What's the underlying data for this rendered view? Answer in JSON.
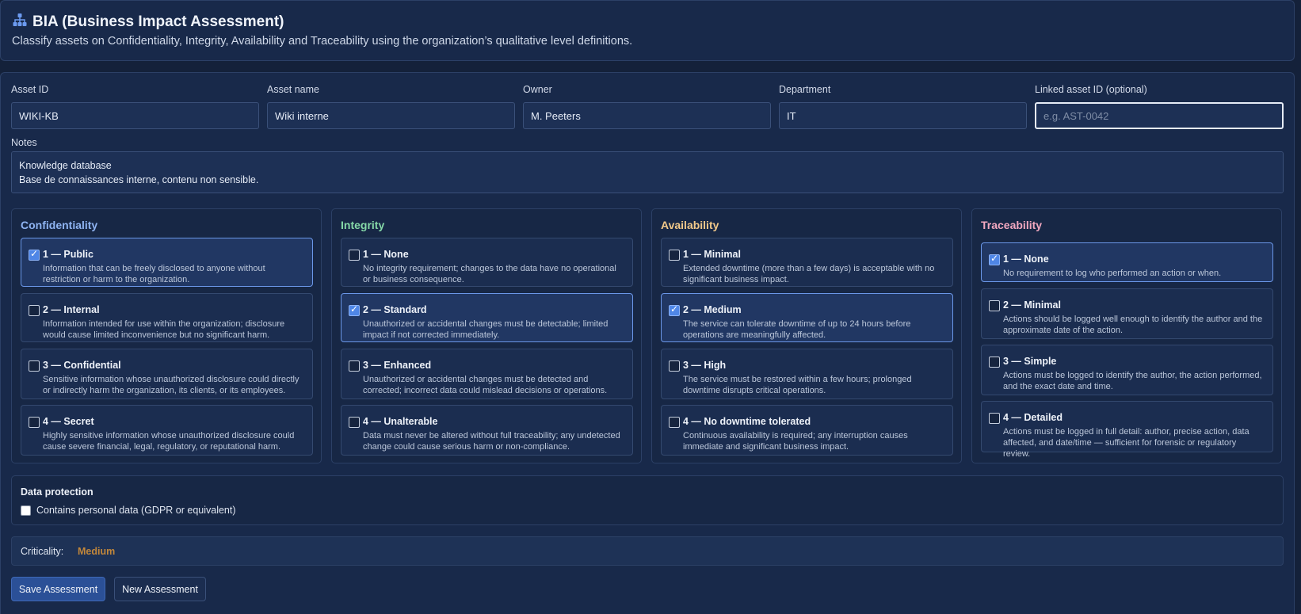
{
  "header": {
    "icon": "sitemap-icon",
    "title": "BIA (Business Impact Assessment)",
    "subtitle": "Classify assets on Confidentiality, Integrity, Availability and Traceability using the organization’s qualitative level definitions."
  },
  "form": {
    "asset_id": {
      "label": "Asset ID",
      "value": "WIKI-KB"
    },
    "asset_name": {
      "label": "Asset name",
      "value": "Wiki interne"
    },
    "owner": {
      "label": "Owner",
      "value": "M. Peeters"
    },
    "department": {
      "label": "Department",
      "value": "IT"
    },
    "linked_asset": {
      "label": "Linked asset ID (optional)",
      "value": "",
      "placeholder": "e.g. AST-0042"
    },
    "notes": {
      "label": "Notes",
      "value": "Knowledge database\nBase de connaissances interne, contenu non sensible."
    }
  },
  "dimensions": [
    {
      "title": "Confidentiality",
      "color": "#8fb4f2",
      "options": [
        {
          "label": "1 — Public",
          "desc": "Information that can be freely disclosed to anyone without restriction or harm to the organization.",
          "checked": true
        },
        {
          "label": "2 — Internal",
          "desc": "Information intended for use within the organization; disclosure would cause limited inconvenience but no significant harm.",
          "checked": false
        },
        {
          "label": "3 — Confidential",
          "desc": "Sensitive information whose unauthorized disclosure could directly or indirectly harm the organization, its clients, or its employees.",
          "checked": false
        },
        {
          "label": "4 — Secret",
          "desc": "Highly sensitive information whose unauthorized disclosure could cause severe financial, legal, regulatory, or reputational harm.",
          "checked": false
        }
      ]
    },
    {
      "title": "Integrity",
      "color": "#86d9a8",
      "options": [
        {
          "label": "1 — None",
          "desc": "No integrity requirement; changes to the data have no operational or business consequence.",
          "checked": false
        },
        {
          "label": "2 — Standard",
          "desc": "Unauthorized or accidental changes must be detectable; limited impact if not corrected immediately.",
          "checked": true
        },
        {
          "label": "3 — Enhanced",
          "desc": "Unauthorized or accidental changes must be detected and corrected; incorrect data could mislead decisions or operations.",
          "checked": false
        },
        {
          "label": "4 — Unalterable",
          "desc": "Data must never be altered without full traceability; any undetected change could cause serious harm or non-compliance.",
          "checked": false
        }
      ]
    },
    {
      "title": "Availability",
      "color": "#f2c98a",
      "options": [
        {
          "label": "1 — Minimal",
          "desc": "Extended downtime (more than a few days) is acceptable with no significant business impact.",
          "checked": false
        },
        {
          "label": "2 — Medium",
          "desc": "The service can tolerate downtime of up to 24 hours before operations are meaningfully affected.",
          "checked": true
        },
        {
          "label": "3 — High",
          "desc": "The service must be restored within a few hours; prolonged downtime disrupts critical operations.",
          "checked": false
        },
        {
          "label": "4 — No downtime tolerated",
          "desc": "Continuous availability is required; any interruption causes immediate and significant business impact.",
          "checked": false
        }
      ]
    },
    {
      "title": "Traceability",
      "color": "#f2a8c0",
      "options": [
        {
          "label": "1 — None",
          "desc": "No requirement to log who performed an action or when.",
          "checked": true
        },
        {
          "label": "2 — Minimal",
          "desc": "Actions should be logged well enough to identify the author and the approximate date of the action.",
          "checked": false
        },
        {
          "label": "3 — Simple",
          "desc": "Actions must be logged to identify the author, the action performed, and the exact date and time.",
          "checked": false
        },
        {
          "label": "4 — Detailed",
          "desc": "Actions must be logged in full detail: author, precise action, data affected, and date/time — sufficient for forensic or regulatory review.",
          "checked": false
        }
      ]
    }
  ],
  "data_protection": {
    "title": "Data protection",
    "personal_data_label": "Contains personal data (GDPR or equivalent)",
    "personal_data_checked": false
  },
  "criticality": {
    "label": "Criticality:",
    "value": "Medium",
    "color": "#c2873a"
  },
  "buttons": {
    "save": "Save Assessment",
    "new": "New Assessment"
  }
}
